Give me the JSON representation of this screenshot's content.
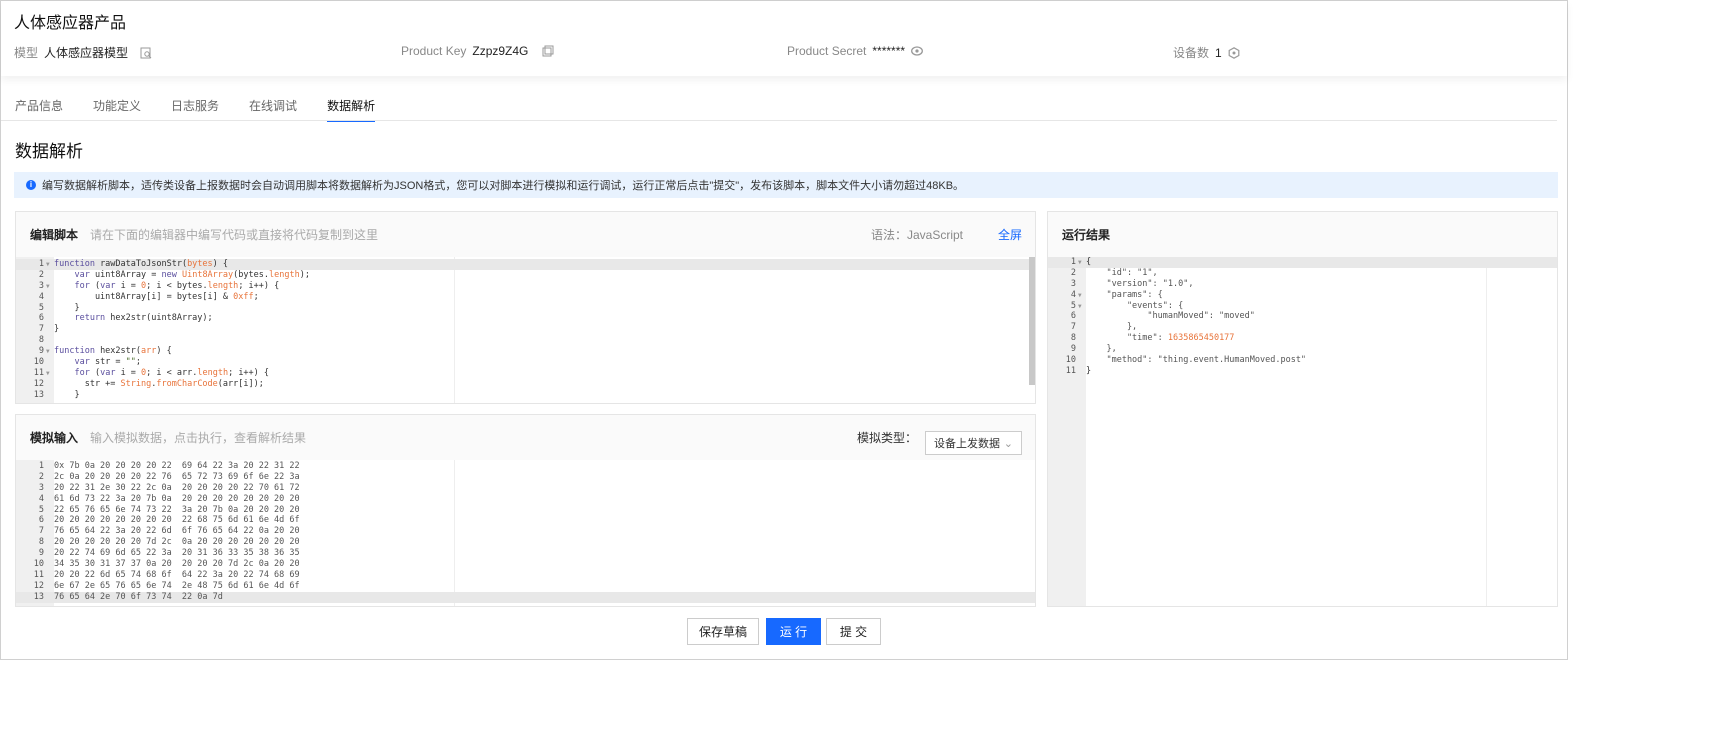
{
  "header": {
    "title": "人体感应器产品",
    "model_label": "模型",
    "model_value": "人体感应器模型",
    "product_key_label": "Product Key",
    "product_key_value": "Zzpz9Z4G",
    "product_secret_label": "Product Secret",
    "product_secret_value": "*******",
    "device_count_label": "设备数",
    "device_count_value": "1"
  },
  "tabs": [
    {
      "label": "产品信息"
    },
    {
      "label": "功能定义"
    },
    {
      "label": "日志服务"
    },
    {
      "label": "在线调试"
    },
    {
      "label": "数据解析",
      "active": true
    }
  ],
  "section_title": "数据解析",
  "info": "编写数据解析脚本，适传类设备上报数据时会自动调用脚本将数据解析为JSON格式，您可以对脚本进行模拟和运行调试，运行正常后点击\"提交\"，发布该脚本，脚本文件大小请勿超过48KB。",
  "editor": {
    "title": "编辑脚本",
    "hint": "请在下面的编辑器中编写代码或直接将代码复制到这里",
    "syntax_label": "语法：JavaScript",
    "fullscreen": "全屏",
    "lines": [
      [
        [
          "kw",
          "function "
        ],
        [
          "id",
          "rawDataToJsonStr("
        ],
        [
          "or",
          "bytes"
        ],
        [
          "pu",
          ") {"
        ]
      ],
      [
        [
          "kw",
          "    var "
        ],
        [
          "id",
          "uint8Array = "
        ],
        [
          "kw",
          "new "
        ],
        [
          "or",
          "Uint8Array"
        ],
        [
          "id",
          "(bytes."
        ],
        [
          "or",
          "length"
        ],
        [
          "pu",
          ");"
        ]
      ],
      [
        [
          "kw",
          "    for "
        ],
        [
          "pu",
          "("
        ],
        [
          "kw",
          "var "
        ],
        [
          "id",
          "i = "
        ],
        [
          "nu",
          "0"
        ],
        [
          "id",
          "; i < bytes."
        ],
        [
          "or",
          "length"
        ],
        [
          "id",
          "; i++) {"
        ]
      ],
      [
        [
          "id",
          "        uint8Array[i] = bytes[i] & "
        ],
        [
          "nu",
          "0xff"
        ],
        [
          "pu",
          ";"
        ]
      ],
      [
        [
          "pu",
          "    }"
        ]
      ],
      [
        [
          "kw",
          "    return "
        ],
        [
          "id",
          "hex2str(uint8Array);"
        ]
      ],
      [
        [
          "pu",
          "}"
        ]
      ],
      [
        [
          "pu",
          ""
        ]
      ],
      [
        [
          "kw",
          "function "
        ],
        [
          "id",
          "hex2str("
        ],
        [
          "or",
          "arr"
        ],
        [
          "pu",
          ") {"
        ]
      ],
      [
        [
          "kw",
          "    var "
        ],
        [
          "id",
          "str = "
        ],
        [
          "st",
          "\"\""
        ],
        [
          "pu",
          ";"
        ]
      ],
      [
        [
          "kw",
          "    for "
        ],
        [
          "pu",
          "("
        ],
        [
          "kw",
          "var "
        ],
        [
          "id",
          "i = "
        ],
        [
          "nu",
          "0"
        ],
        [
          "id",
          "; i < arr."
        ],
        [
          "or",
          "length"
        ],
        [
          "id",
          "; i++) {"
        ]
      ],
      [
        [
          "id",
          "      str += "
        ],
        [
          "or",
          "String"
        ],
        [
          "id",
          "."
        ],
        [
          "or",
          "fromCharCode"
        ],
        [
          "id",
          "(arr[i]);"
        ]
      ],
      [
        [
          "pu",
          "    }"
        ]
      ]
    ],
    "folds": [
      1,
      3,
      9,
      11
    ]
  },
  "simulate": {
    "title": "模拟输入",
    "hint": "输入模拟数据，点击执行，查看解析结果",
    "type_label": "模拟类型：",
    "type_value": "设备上发数据",
    "lines": [
      "0x 7b 0a 20 20 20 20 22  69 64 22 3a 20 22 31 22",
      "2c 0a 20 20 20 20 22 76  65 72 73 69 6f 6e 22 3a",
      "20 22 31 2e 30 22 2c 0a  20 20 20 20 22 70 61 72",
      "61 6d 73 22 3a 20 7b 0a  20 20 20 20 20 20 20 20",
      "22 65 76 65 6e 74 73 22  3a 20 7b 0a 20 20 20 20",
      "20 20 20 20 20 20 20 20  22 68 75 6d 61 6e 4d 6f",
      "76 65 64 22 3a 20 22 6d  6f 76 65 64 22 0a 20 20",
      "20 20 20 20 20 20 7d 2c  0a 20 20 20 20 20 20 20",
      "20 22 74 69 6d 65 22 3a  20 31 36 33 35 38 36 35",
      "34 35 30 31 37 37 0a 20  20 20 20 7d 2c 0a 20 20",
      "20 20 22 6d 65 74 68 6f  64 22 3a 20 22 74 68 69",
      "6e 67 2e 65 76 65 6e 74  2e 48 75 6d 61 6e 4d 6f",
      "76 65 64 2e 70 6f 73 74  22 0a 7d"
    ]
  },
  "result": {
    "title": "运行结果",
    "lines": [
      [
        [
          "pu",
          "{"
        ]
      ],
      [
        [
          "jstr",
          "    \"id\": \"1\","
        ]
      ],
      [
        [
          "jstr",
          "    \"version\": \"1.0\","
        ]
      ],
      [
        [
          "jstr",
          "    \"params\": {"
        ]
      ],
      [
        [
          "jstr",
          "        \"events\": {"
        ]
      ],
      [
        [
          "jstr",
          "            \"humanMoved\": \"moved\""
        ]
      ],
      [
        [
          "jstr",
          "        },"
        ]
      ],
      [
        [
          "jstr",
          "        \"time\": "
        ],
        [
          "jnum",
          "1635865450177"
        ]
      ],
      [
        [
          "jstr",
          "    },"
        ]
      ],
      [
        [
          "jstr",
          "    \"method\": \"thing.event.HumanMoved.post\""
        ]
      ],
      [
        [
          "pu",
          "}"
        ]
      ]
    ],
    "folds": [
      1,
      4,
      5
    ]
  },
  "buttons": {
    "save_draft": "保存草稿",
    "run": "运 行",
    "submit": "提 交"
  },
  "colors": {
    "accent": "#1769ff",
    "info_bg": "#e8f2fe"
  }
}
